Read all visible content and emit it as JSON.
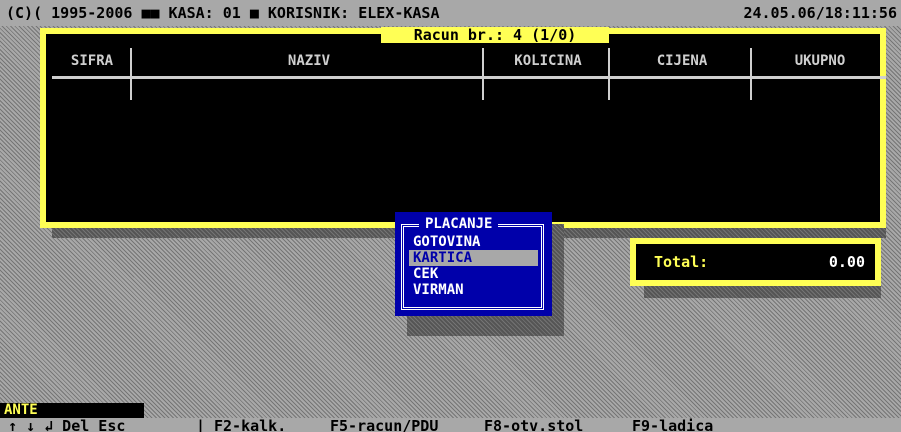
{
  "topbar": {
    "left": "(C)( 1995-2006 ■■ KASA: 01 ■ KORISNIK: ELEX-KASA",
    "right": "24.05.06/18:11:56"
  },
  "receipt": {
    "title": "Racun br.: 4 (1/0)",
    "columns": [
      "SIFRA",
      "NAZIV",
      "KOLICINA",
      "CIJENA",
      "UKUPNO"
    ]
  },
  "payment": {
    "title": "PLACANJE",
    "items": [
      "GOTOVINA",
      "KARTICA",
      "CEK",
      "VIRMAN"
    ],
    "selected": "KARTICA"
  },
  "total": {
    "label": "Total:",
    "value": "0.00"
  },
  "user": "ANTE",
  "statusbar": {
    "keys": "↑ ↓ ↲ Del Esc",
    "separator": "|",
    "shortcuts": [
      "F2-kalk.",
      "F5-racun/PDU",
      "F8-otv.stol",
      "F9-ladica"
    ]
  },
  "colors": {
    "window_border": "#ffff55",
    "window_bg": "#000000",
    "popup_bg": "#0000aa",
    "desktop": "#a8a8a8"
  }
}
